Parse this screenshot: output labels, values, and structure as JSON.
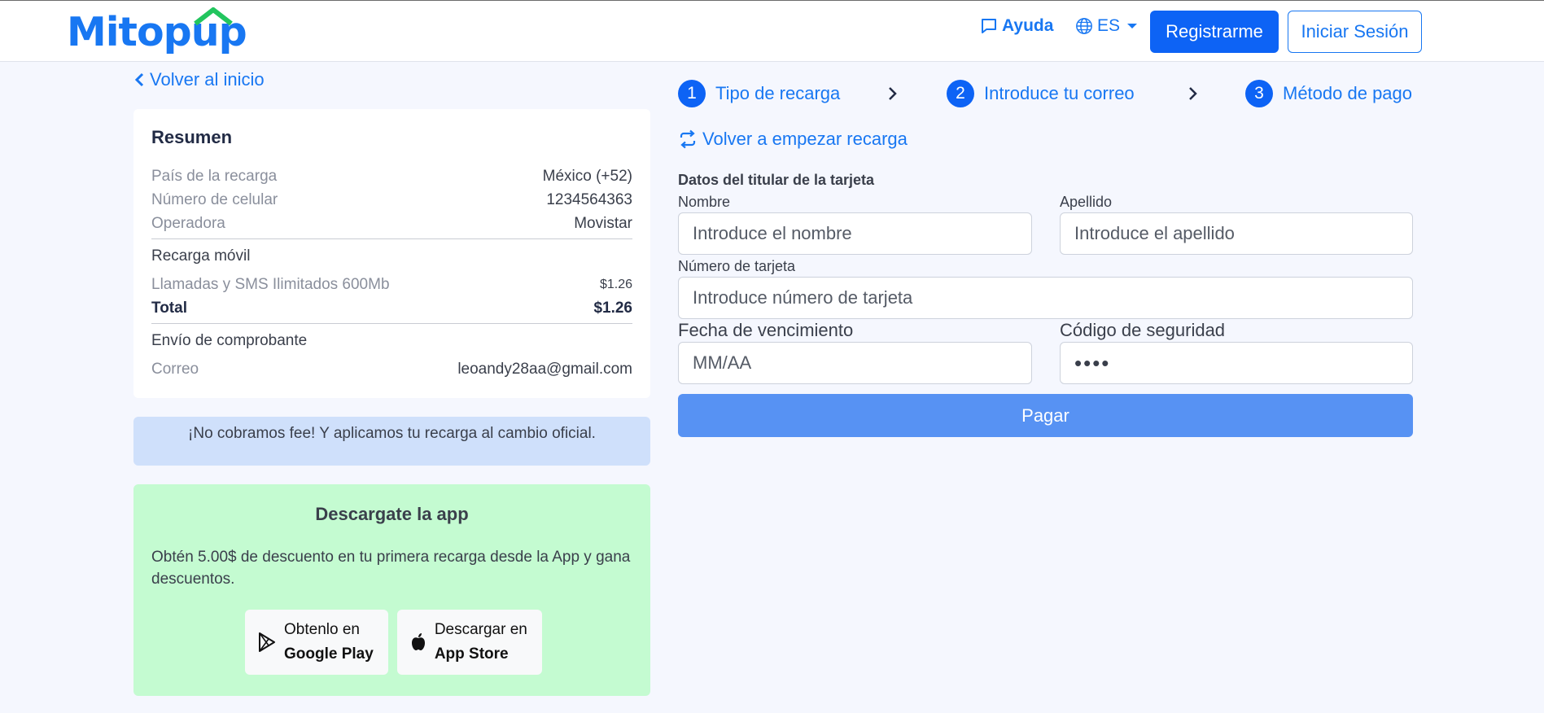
{
  "header": {
    "logo": "Mitopup",
    "help_label": "Ayuda",
    "lang_label": "ES",
    "register_label": "Registrarme",
    "login_label": "Iniciar Sesión"
  },
  "back_link": "Volver al inicio",
  "summary": {
    "title": "Resumen",
    "rows": [
      {
        "label": "País de la recarga",
        "value": "México (+52)"
      },
      {
        "label": "Número de celular",
        "value": "1234564363"
      },
      {
        "label": "Operadora",
        "value": "Movistar"
      }
    ],
    "recharge_title": "Recarga móvil",
    "plan_label": "Llamadas y SMS Ilimitados 600Mb",
    "plan_price": "$1.26",
    "total_label": "Total",
    "total_value": "$1.26",
    "receipt_title": "Envío de comprobante",
    "email_label": "Correo",
    "email_value": "leoandy28aa@gmail.com"
  },
  "info_box": "¡No cobramos fee! Y aplicamos tu recarga al cambio oficial.",
  "app_box": {
    "title": "Descargate la app",
    "text": "Obtén 5.00$ de descuento en tu primera recarga desde la App y gana descuentos.",
    "google_line1": "Obtenlo en",
    "google_line2": "Google Play",
    "apple_line1": "Descargar en",
    "apple_line2": "App Store"
  },
  "steps": [
    {
      "num": "1",
      "label": "Tipo de recarga"
    },
    {
      "num": "2",
      "label": "Introduce tu correo"
    },
    {
      "num": "3",
      "label": "Método de pago"
    }
  ],
  "restart_label": "Volver a empezar recarga",
  "form": {
    "title": "Datos del titular de la tarjeta",
    "first_name_label": "Nombre",
    "first_name_placeholder": "Introduce el nombre",
    "last_name_label": "Apellido",
    "last_name_placeholder": "Introduce el apellido",
    "card_label": "Número de tarjeta",
    "card_placeholder": "Introduce número de tarjeta",
    "expiry_label": "Fecha de vencimiento",
    "expiry_placeholder": "MM/AA",
    "cvv_label": "Código de seguridad",
    "cvv_value": "••••",
    "pay_label": "Pagar"
  },
  "colors": {
    "brand": "#1877f2",
    "primary_button": "#0d63f5",
    "pay_button": "#5792f3",
    "info_bg": "#cfe0fb",
    "app_bg": "#c4fbd1",
    "page_bg": "#f5f7fe"
  }
}
